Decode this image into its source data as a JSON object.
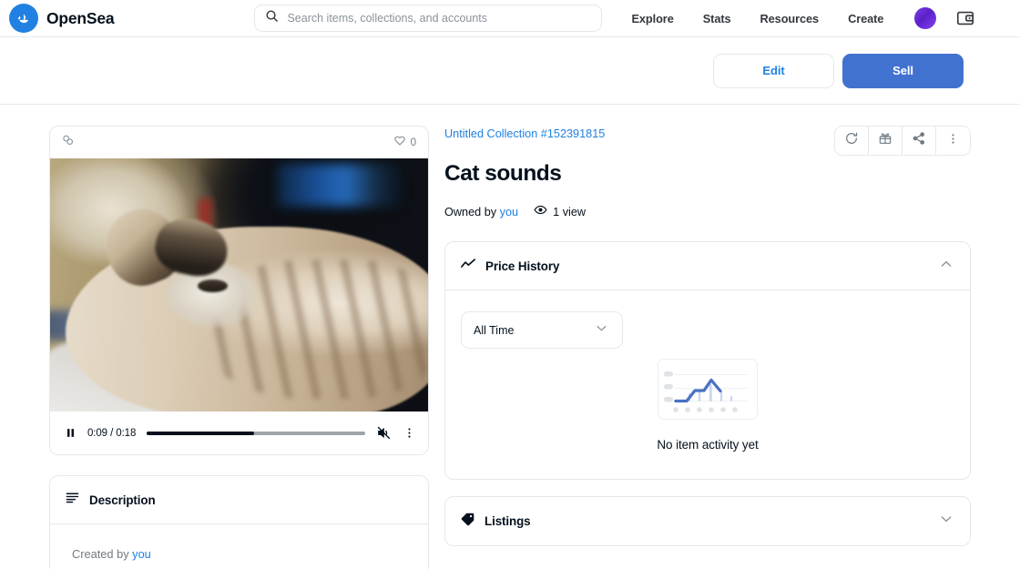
{
  "header": {
    "brand": "OpenSea",
    "logo_icon": "opensea-boat-logo",
    "search": {
      "placeholder": "Search items, collections, and accounts",
      "value": ""
    },
    "nav": [
      {
        "label": "Explore",
        "name": "nav-explore"
      },
      {
        "label": "Stats",
        "name": "nav-stats"
      },
      {
        "label": "Resources",
        "name": "nav-resources"
      },
      {
        "label": "Create",
        "name": "nav-create"
      }
    ],
    "avatar_icon": "profile-avatar",
    "wallet_icon": "wallet-icon",
    "accent_color": "#2081e2"
  },
  "actionbar": {
    "edit_label": "Edit",
    "sell_label": "Sell",
    "sell_color": "#4272d0",
    "edit_color": "#2081e2"
  },
  "media": {
    "chain_icon": "chain-link-icon",
    "like_icon": "heart-icon",
    "like_count": "0",
    "alt": "cat lying on back",
    "controls": {
      "play_state_icon": "pause-icon",
      "time": "0:09 / 0:18",
      "current_time": "0:09",
      "duration": "0:18",
      "progress_percent": 49,
      "volume_icon": "volume-muted-icon",
      "more_icon": "kebab-menu-icon"
    }
  },
  "description": {
    "icon": "description-lines-icon",
    "title": "Description",
    "created_by_prefix": "Created by",
    "created_by": "you",
    "collapse_state": "expanded"
  },
  "item": {
    "collection": "Untitled Collection #152391815",
    "title": "Cat sounds",
    "owned_by_prefix": "Owned by",
    "owner": "you",
    "views_icon": "eye-icon",
    "views": "1 view",
    "tools": [
      {
        "name": "refresh-metadata-button",
        "icon": "refresh-icon"
      },
      {
        "name": "gift-button",
        "icon": "gift-icon"
      },
      {
        "name": "share-button",
        "icon": "share-icon"
      },
      {
        "name": "more-options-button",
        "icon": "kebab-menu-icon"
      }
    ]
  },
  "price_history": {
    "icon": "line-chart-icon",
    "title": "Price History",
    "chevron": "chevron-up-icon",
    "collapse_state": "expanded",
    "range_filter": {
      "selected": "All Time",
      "chevron": "chevron-down-icon"
    },
    "empty_text": "No item activity yet",
    "empty_illustration": "line-chart-placeholder"
  },
  "listings": {
    "icon": "price-tag-icon",
    "title": "Listings",
    "chevron": "chevron-down-icon",
    "collapse_state": "collapsed"
  },
  "chart_data": {
    "type": "line",
    "title": "Price History",
    "xlabel": "",
    "ylabel": "",
    "categories": [],
    "values": [],
    "series": [],
    "legend": "none",
    "grid": false,
    "note": "No item activity yet - chart is an empty-state placeholder illustration"
  }
}
